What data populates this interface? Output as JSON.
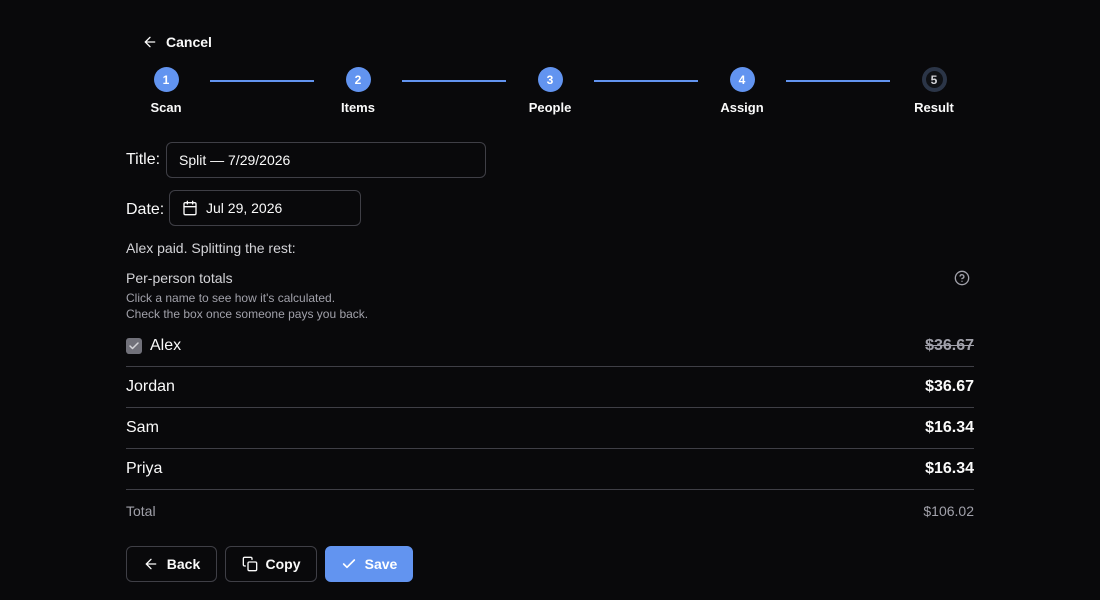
{
  "nav": {
    "cancel_label": "Cancel",
    "cancel_icon": "arrow-left-icon"
  },
  "stepper": {
    "accent": "#6294f0",
    "steps": [
      {
        "number": "1",
        "label": "Scan",
        "state": "complete"
      },
      {
        "number": "2",
        "label": "Items",
        "state": "complete"
      },
      {
        "number": "3",
        "label": "People",
        "state": "complete"
      },
      {
        "number": "4",
        "label": "Assign",
        "state": "complete"
      },
      {
        "number": "5",
        "label": "Result",
        "state": "current"
      }
    ]
  },
  "form": {
    "title_label": "Title:",
    "title_value": "Split — 7/29/2026",
    "date_label": "Date:",
    "date_value": "Jul 29, 2026",
    "date_icon": "calendar-icon"
  },
  "summary": {
    "paid_note": "Alex paid. Splitting the rest:",
    "totals_title": "Per-person totals",
    "hint_line1": "Click a name to see how it's calculated.",
    "hint_line2": "Check the box once someone pays you back.",
    "help_icon": "help-circle-icon"
  },
  "people": [
    {
      "name": "Alex",
      "amount": "$36.67",
      "paid": true,
      "checkbox": true
    },
    {
      "name": "Jordan",
      "amount": "$36.67",
      "paid": false,
      "checkbox": false
    },
    {
      "name": "Sam",
      "amount": "$16.34",
      "paid": false,
      "checkbox": false
    },
    {
      "name": "Priya",
      "amount": "$16.34",
      "paid": false,
      "checkbox": false
    }
  ],
  "total": {
    "label": "Total",
    "value": "$106.02"
  },
  "actions": {
    "back_label": "Back",
    "copy_label": "Copy",
    "save_label": "Save",
    "primary_color": "#6294f0"
  }
}
